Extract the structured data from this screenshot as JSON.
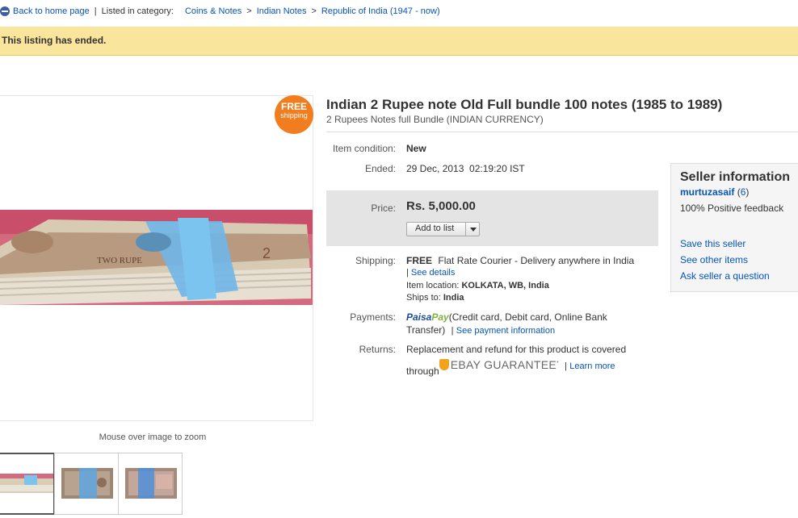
{
  "breadcrumb": {
    "back": "Back to home page",
    "listed_in": "Listed in category:",
    "items": [
      "Coins & Notes",
      "Indian Notes",
      "Republic of India (1947 - now)"
    ]
  },
  "banner": {
    "text": "This listing has ended."
  },
  "badge": {
    "line1": "FREE",
    "line2": "shipping"
  },
  "image": {
    "zoom_hint": "Mouse over image to zoom"
  },
  "listing": {
    "title": "Indian 2 Rupee note Old Full bundle 100 notes (1985 to 1989)",
    "subtitle": "2 Rupees Notes full Bundle (INDIAN CURRENCY)",
    "condition_label": "Item condition:",
    "condition_value": "New",
    "ended_label": "Ended:",
    "ended_value": "29 Dec, 2013  02:19:20 IST",
    "price_label": "Price:",
    "price_value": "Rs. 5,000.00",
    "add_to_list": "Add to list",
    "shipping_label": "Shipping:",
    "shipping_free": "FREE",
    "shipping_desc": "Flat Rate Courier - Delivery anywhere in India",
    "see_details": "See details",
    "item_location_label": "Item location:",
    "item_location_value": "KOLKATA, WB, India",
    "ships_to_label": "Ships to:",
    "ships_to_value": "India",
    "payments_label": "Payments:",
    "paisa_a": "Paisa",
    "paisa_b": "Pay",
    "payments_line1": "(Credit card, Debit card, Online Bank",
    "payments_line2": "Transfer)",
    "see_payment_info": "See payment information",
    "returns_label": "Returns:",
    "returns_line1": "Replacement and refund for this product is covered",
    "returns_through": "through",
    "guarantee": "EBAY GUARANTEE",
    "guarantee_mark": "*",
    "learn_more": "Learn more"
  },
  "seller": {
    "title": "Seller information",
    "name": "murtuzasaif",
    "score": "6",
    "feedback": "100% Positive feedback",
    "save": "Save this seller",
    "other": "See other items",
    "ask": "Ask seller a question"
  },
  "colors": {
    "link": "#0654ba",
    "banner": "#f9e59b",
    "badge": "#f17d1f",
    "price_box": "#e4e4e4"
  }
}
